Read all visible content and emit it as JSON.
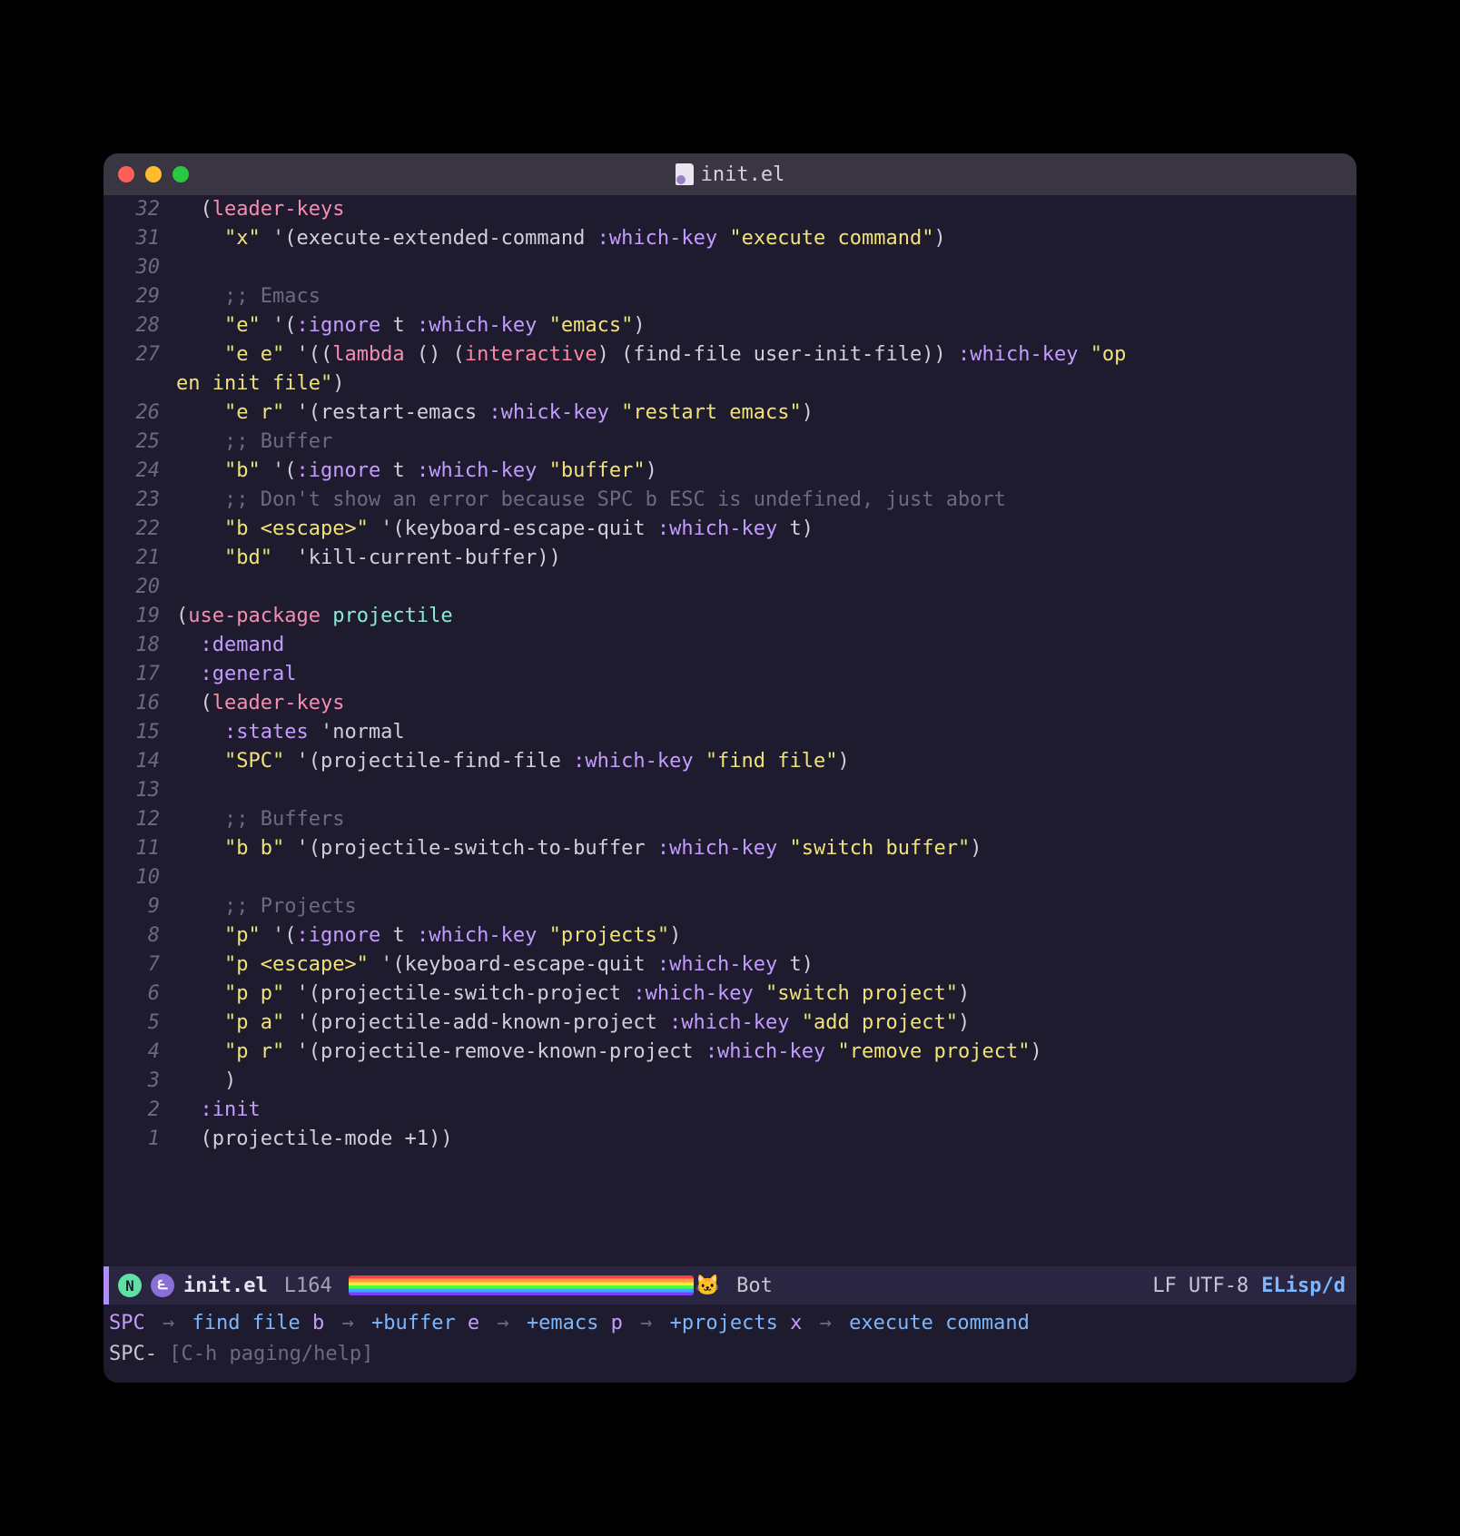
{
  "titlebar": {
    "filename": "init.el"
  },
  "lines": [
    {
      "n": "32",
      "tokens": [
        [
          "  (",
          "par"
        ],
        [
          "leader-keys",
          "fn"
        ]
      ]
    },
    {
      "n": "31",
      "tokens": [
        [
          "    ",
          "par"
        ],
        [
          "\"x\"",
          "str"
        ],
        [
          " '(",
          "par"
        ],
        [
          "execute-extended-command ",
          "par"
        ],
        [
          ":which-key",
          "kw"
        ],
        [
          " ",
          "par"
        ],
        [
          "\"execute command\"",
          "str"
        ],
        [
          ")",
          "par"
        ]
      ]
    },
    {
      "n": "30",
      "tokens": [
        [
          "",
          "par"
        ]
      ]
    },
    {
      "n": "29",
      "tokens": [
        [
          "    ",
          "par"
        ],
        [
          ";; Emacs",
          "com"
        ]
      ]
    },
    {
      "n": "28",
      "tokens": [
        [
          "    ",
          "par"
        ],
        [
          "\"e\"",
          "str"
        ],
        [
          " '(",
          "par"
        ],
        [
          ":ignore",
          "kw"
        ],
        [
          " t ",
          "par"
        ],
        [
          ":which-key",
          "kw"
        ],
        [
          " ",
          "par"
        ],
        [
          "\"emacs\"",
          "str"
        ],
        [
          ")",
          "par"
        ]
      ]
    },
    {
      "n": "27",
      "tokens": [
        [
          "    ",
          "par"
        ],
        [
          "\"e e\"",
          "str"
        ],
        [
          " '((",
          "par"
        ],
        [
          "lambda",
          "fn"
        ],
        [
          " () (",
          "par"
        ],
        [
          "interactive",
          "kw2"
        ],
        [
          ") (find-file user-init-file)) ",
          "par"
        ],
        [
          ":which-key",
          "kw"
        ],
        [
          " ",
          "par"
        ],
        [
          "\"op",
          "str"
        ]
      ]
    },
    {
      "n": "",
      "tokens": [
        [
          "en init file\"",
          "str"
        ],
        [
          ")",
          "par"
        ]
      ],
      "wrap": true
    },
    {
      "n": "26",
      "tokens": [
        [
          "    ",
          "par"
        ],
        [
          "\"e r\"",
          "str"
        ],
        [
          " '(restart-emacs ",
          "par"
        ],
        [
          ":whick-key",
          "kw"
        ],
        [
          " ",
          "par"
        ],
        [
          "\"restart emacs\"",
          "str"
        ],
        [
          ")",
          "par"
        ]
      ]
    },
    {
      "n": "25",
      "tokens": [
        [
          "    ",
          "par"
        ],
        [
          ";; Buffer",
          "com"
        ]
      ]
    },
    {
      "n": "24",
      "tokens": [
        [
          "    ",
          "par"
        ],
        [
          "\"b\"",
          "str"
        ],
        [
          " '(",
          "par"
        ],
        [
          ":ignore",
          "kw"
        ],
        [
          " t ",
          "par"
        ],
        [
          ":which-key",
          "kw"
        ],
        [
          " ",
          "par"
        ],
        [
          "\"buffer\"",
          "str"
        ],
        [
          ")",
          "par"
        ]
      ]
    },
    {
      "n": "23",
      "tokens": [
        [
          "    ",
          "par"
        ],
        [
          ";; Don't show an error because SPC b ESC is undefined, just abort",
          "com"
        ]
      ]
    },
    {
      "n": "22",
      "tokens": [
        [
          "    ",
          "par"
        ],
        [
          "\"b <escape>\"",
          "str"
        ],
        [
          " '(keyboard-escape-quit ",
          "par"
        ],
        [
          ":which-key",
          "kw"
        ],
        [
          " t)",
          "par"
        ]
      ]
    },
    {
      "n": "21",
      "tokens": [
        [
          "    ",
          "par"
        ],
        [
          "\"bd\"",
          "str"
        ],
        [
          "  'kill-current-buffer))",
          "par"
        ]
      ]
    },
    {
      "n": "20",
      "tokens": [
        [
          "",
          "par"
        ]
      ]
    },
    {
      "n": "19",
      "tokens": [
        [
          "(",
          "par"
        ],
        [
          "use-package",
          "fn"
        ],
        [
          " ",
          "par"
        ],
        [
          "projectile",
          "sym"
        ]
      ]
    },
    {
      "n": "18",
      "tokens": [
        [
          "  ",
          "par"
        ],
        [
          ":demand",
          "kw"
        ]
      ]
    },
    {
      "n": "17",
      "tokens": [
        [
          "  ",
          "par"
        ],
        [
          ":general",
          "kw"
        ]
      ]
    },
    {
      "n": "16",
      "tokens": [
        [
          "  (",
          "par"
        ],
        [
          "leader-keys",
          "fn"
        ]
      ]
    },
    {
      "n": "15",
      "tokens": [
        [
          "    ",
          "par"
        ],
        [
          ":states",
          "kw"
        ],
        [
          " 'normal",
          "par"
        ]
      ]
    },
    {
      "n": "14",
      "tokens": [
        [
          "    ",
          "par"
        ],
        [
          "\"SPC\"",
          "str"
        ],
        [
          " '(projectile-find-file ",
          "par"
        ],
        [
          ":which-key",
          "kw"
        ],
        [
          " ",
          "par"
        ],
        [
          "\"find file\"",
          "str"
        ],
        [
          ")",
          "par"
        ]
      ]
    },
    {
      "n": "13",
      "tokens": [
        [
          "",
          "par"
        ]
      ]
    },
    {
      "n": "12",
      "tokens": [
        [
          "    ",
          "par"
        ],
        [
          ";; Buffers",
          "com"
        ]
      ]
    },
    {
      "n": "11",
      "tokens": [
        [
          "    ",
          "par"
        ],
        [
          "\"b b\"",
          "str"
        ],
        [
          " '(projectile-switch-to-buffer ",
          "par"
        ],
        [
          ":which-key",
          "kw"
        ],
        [
          " ",
          "par"
        ],
        [
          "\"switch buffer\"",
          "str"
        ],
        [
          ")",
          "par"
        ]
      ]
    },
    {
      "n": "10",
      "tokens": [
        [
          "",
          "par"
        ]
      ]
    },
    {
      "n": "9",
      "tokens": [
        [
          "    ",
          "par"
        ],
        [
          ";; Projects",
          "com"
        ]
      ]
    },
    {
      "n": "8",
      "tokens": [
        [
          "    ",
          "par"
        ],
        [
          "\"p\"",
          "str"
        ],
        [
          " '(",
          "par"
        ],
        [
          ":ignore",
          "kw"
        ],
        [
          " t ",
          "par"
        ],
        [
          ":which-key",
          "kw"
        ],
        [
          " ",
          "par"
        ],
        [
          "\"projects\"",
          "str"
        ],
        [
          ")",
          "par"
        ]
      ]
    },
    {
      "n": "7",
      "tokens": [
        [
          "    ",
          "par"
        ],
        [
          "\"p <escape>\"",
          "str"
        ],
        [
          " '(keyboard-escape-quit ",
          "par"
        ],
        [
          ":which-key",
          "kw"
        ],
        [
          " t)",
          "par"
        ]
      ]
    },
    {
      "n": "6",
      "tokens": [
        [
          "    ",
          "par"
        ],
        [
          "\"p p\"",
          "str"
        ],
        [
          " '(projectile-switch-project ",
          "par"
        ],
        [
          ":which-key",
          "kw"
        ],
        [
          " ",
          "par"
        ],
        [
          "\"switch project\"",
          "str"
        ],
        [
          ")",
          "par"
        ]
      ]
    },
    {
      "n": "5",
      "tokens": [
        [
          "    ",
          "par"
        ],
        [
          "\"p a\"",
          "str"
        ],
        [
          " '(projectile-add-known-project ",
          "par"
        ],
        [
          ":which-key",
          "kw"
        ],
        [
          " ",
          "par"
        ],
        [
          "\"add project\"",
          "str"
        ],
        [
          ")",
          "par"
        ]
      ]
    },
    {
      "n": "4",
      "tokens": [
        [
          "    ",
          "par"
        ],
        [
          "\"p r\"",
          "str"
        ],
        [
          " '(projectile-remove-known-project ",
          "par"
        ],
        [
          ":which-key",
          "kw"
        ],
        [
          " ",
          "par"
        ],
        [
          "\"remove project\"",
          "str"
        ],
        [
          ")",
          "par"
        ]
      ]
    },
    {
      "n": "3",
      "tokens": [
        [
          "    )",
          "par"
        ]
      ]
    },
    {
      "n": "2",
      "tokens": [
        [
          "  ",
          "par"
        ],
        [
          ":init",
          "kw"
        ]
      ]
    },
    {
      "n": "1",
      "tokens": [
        [
          "  (projectile-mode +1))",
          "par"
        ]
      ]
    }
  ],
  "modeline": {
    "state": "N",
    "icon": "౬",
    "filename": "init.el",
    "position": "L164",
    "scroll": "Bot",
    "encoding": "LF UTF-8",
    "mode": "ELisp/d"
  },
  "whichkey": {
    "line1": [
      [
        "SPC",
        "wk-key"
      ],
      [
        "→",
        "wk-arrow"
      ],
      [
        "find file",
        "wk-cmd"
      ],
      [
        " b",
        "wk-key"
      ],
      [
        "→",
        "wk-arrow"
      ],
      [
        "+buffer",
        "wk-plus"
      ],
      [
        " e",
        "wk-key"
      ],
      [
        "→",
        "wk-arrow"
      ],
      [
        "+emacs",
        "wk-plus"
      ],
      [
        " p",
        "wk-key"
      ],
      [
        "→",
        "wk-arrow"
      ],
      [
        "+projects",
        "wk-plus"
      ],
      [
        " x",
        "wk-key"
      ],
      [
        "→",
        "wk-arrow"
      ],
      [
        "execute command",
        "wk-cmd"
      ]
    ],
    "prefix": "SPC-",
    "help": "[C-h paging/help]"
  }
}
